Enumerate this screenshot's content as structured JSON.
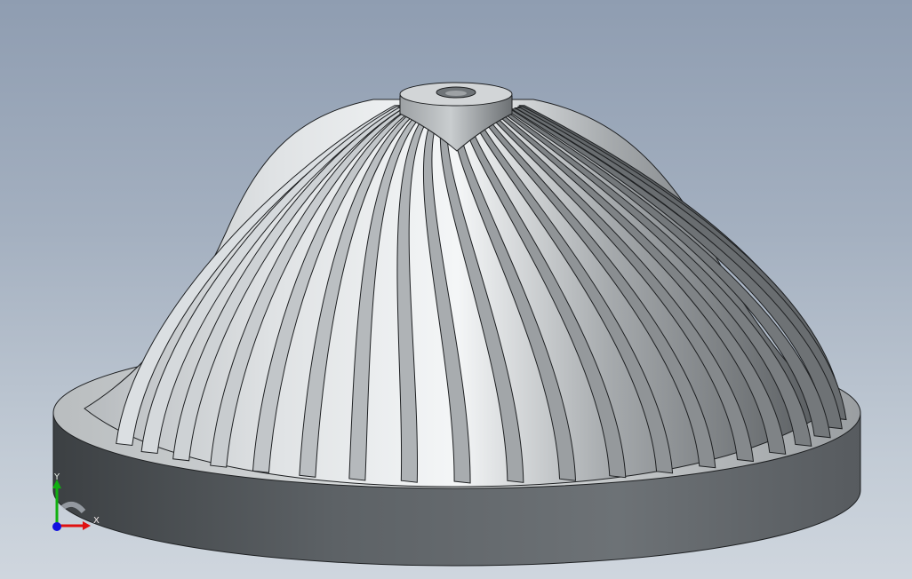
{
  "viewport": {
    "background_top": "#8f9db1",
    "background_bottom": "#cfd6de"
  },
  "model": {
    "part": "impeller",
    "blade_count": 22,
    "colors": {
      "base_side": "#666b6f",
      "base_top": "#c0c4c6",
      "hub_light": "#f4f6f7",
      "blade_dark": "#3d4144",
      "blade_light": "#e9ecee",
      "outline": "#1e2022"
    }
  },
  "triad": {
    "x_label": "X",
    "y_label": "Y",
    "x_color": "#e01010",
    "y_color": "#10b010",
    "z_color": "#1010e0"
  }
}
